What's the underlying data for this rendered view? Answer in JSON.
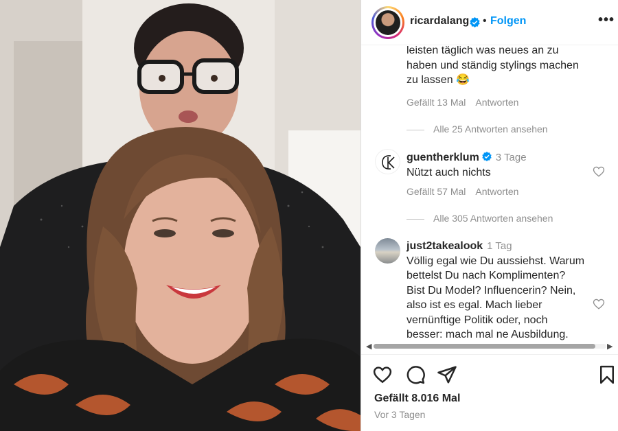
{
  "post": {
    "username": "ricardalang",
    "follow_label": "Folgen",
    "separator": "•",
    "more_label": "•••",
    "likes_text": "Gefällt 8.016 Mal",
    "date_text": "Vor 3 Tagen"
  },
  "comments": [
    {
      "text_lines": [
        "leisten täglich was neues an zu",
        "haben und ständig stylings machen",
        "zu lassen 😂"
      ],
      "likes": "Gefällt 13 Mal",
      "reply_label": "Antworten",
      "view_replies": "Alle 25 Antworten ansehen"
    },
    {
      "username": "guentherklum",
      "time": "3 Tage",
      "text_lines": [
        "Nützt auch nichts"
      ],
      "likes": "Gefällt 57 Mal",
      "reply_label": "Antworten",
      "view_replies": "Alle 305 Antworten ansehen",
      "avatar_monogram": "GK"
    },
    {
      "username": "just2takealook",
      "time": "1 Tag",
      "text_lines": [
        "Völlig egal wie Du aussiehst. Warum",
        "bettelst Du nach Komplimenten?",
        "Bist Du Model? Influencerin? Nein,",
        "also ist es egal. Mach lieber",
        "vernünftige Politik oder, noch",
        "besser: mach mal ne Ausbildung."
      ]
    }
  ],
  "icons": {
    "like": "heart-icon",
    "comment": "comment-icon",
    "share": "send-icon",
    "save": "bookmark-icon",
    "verified": "verified-badge-icon",
    "more": "more-options-icon"
  },
  "colors": {
    "accent": "#0095f6",
    "verified": "#0095f6",
    "muted": "#8e8e8e"
  }
}
